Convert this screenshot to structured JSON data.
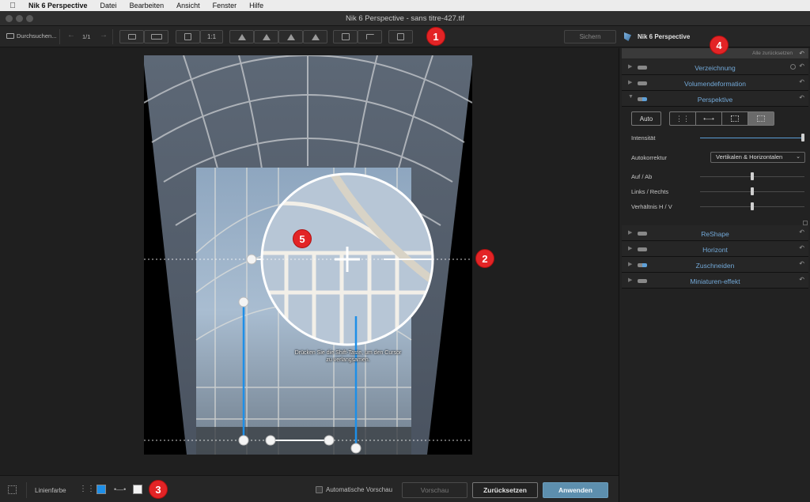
{
  "menubar": {
    "app_name": "Nik 6 Perspective",
    "items": [
      "Datei",
      "Bearbeiten",
      "Ansicht",
      "Fenster",
      "Hilfe"
    ]
  },
  "window": {
    "title": "Nik 6 Perspective - sans titre-427.tif"
  },
  "toolbar": {
    "browse_label": "Durchsuchen...",
    "page_counter": "1/1",
    "zoom_1to1": "1:1",
    "save_label": "Sichern",
    "brand_label": "Nik 6 Perspective"
  },
  "panel": {
    "reset_all_label": "Alle zurücksetzen",
    "sections": [
      {
        "name": "Verzeichnung",
        "expanded": false
      },
      {
        "name": "Volumendeformation",
        "expanded": false
      },
      {
        "name": "Perspektive",
        "expanded": true
      },
      {
        "name": "ReShape",
        "expanded": false
      },
      {
        "name": "Horizont",
        "expanded": false
      },
      {
        "name": "Zuschneiden",
        "expanded": false
      },
      {
        "name": "Miniaturen-effekt",
        "expanded": false
      }
    ],
    "perspective": {
      "auto_label": "Auto",
      "intensity_label": "Intensität",
      "intensity_value": 1.0,
      "autocorrection_label": "Autokorrektur",
      "autocorrection_value": "Vertikalen & Horizontalen",
      "up_down_label": "Auf / Ab",
      "up_down_value": 0.5,
      "left_right_label": "Links / Rechts",
      "left_right_value": 0.5,
      "ratio_label": "Verhältnis H / V",
      "ratio_value": 0.5
    }
  },
  "canvas": {
    "hint_text": "Drücken Sie die Shift-Taste, um den Cursor zu verlangsamen."
  },
  "bottombar": {
    "line_color_label": "Linienfarbe",
    "vertical_line_color": "#1e8fe8",
    "horizontal_line_color": "#f2f2f2",
    "auto_preview_label": "Automatische Vorschau",
    "preview_label": "Vorschau",
    "reset_label": "Zurücksetzen",
    "apply_label": "Anwenden"
  },
  "badges": [
    "1",
    "2",
    "3",
    "4",
    "5"
  ],
  "colors": {
    "accent_blue": "#73a9d8",
    "apply_button": "#5d8fae",
    "badge_red": "#e32426"
  }
}
